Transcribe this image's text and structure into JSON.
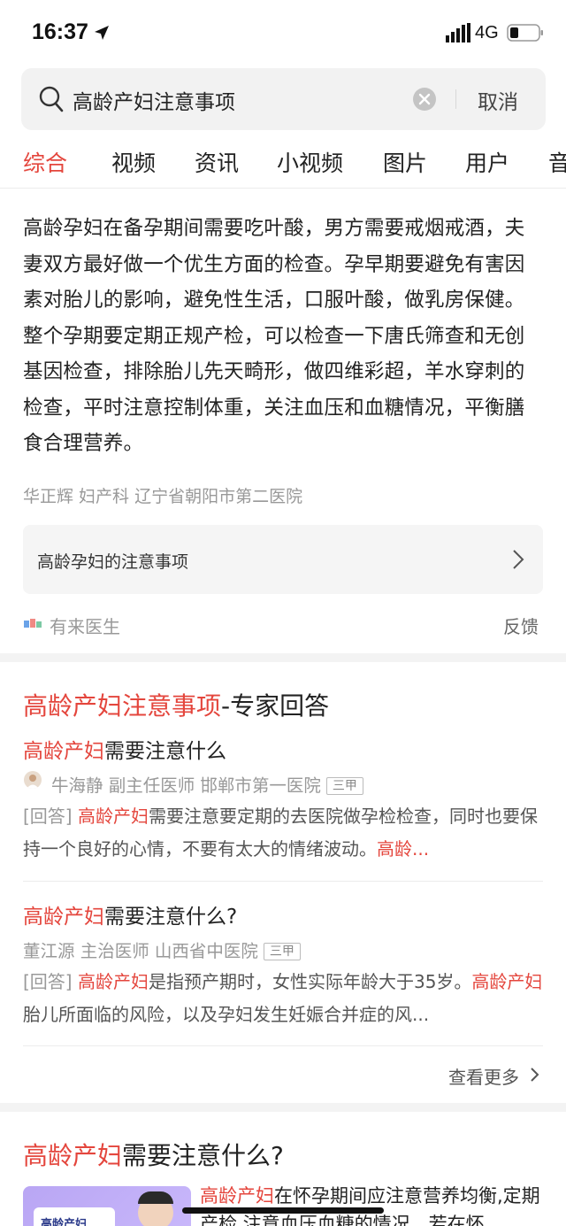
{
  "status_bar": {
    "time": "16:37",
    "network": "4G",
    "icons": [
      "location-arrow-icon",
      "signal-icon",
      "battery-icon"
    ]
  },
  "search": {
    "query": "高龄产妇注意事项",
    "cancel_label": "取消"
  },
  "tabs": [
    {
      "label": "综合",
      "active": true
    },
    {
      "label": "视频"
    },
    {
      "label": "资讯"
    },
    {
      "label": "小视频"
    },
    {
      "label": "图片"
    },
    {
      "label": "用户"
    },
    {
      "label": "音"
    }
  ],
  "answer_card": {
    "text": "高龄孕妇在备孕期间需要吃叶酸，男方需要戒烟戒酒，夫妻双方最好做一个优生方面的检查。孕早期要避免有害因素对胎儿的影响，避免性生活，口服叶酸，做乳房保健。整个孕期要定期正规产检，可以检查一下唐氏筛查和无创基因检查，排除胎儿先天畸形，做四维彩超，羊水穿刺的检查，平时注意控制体重，关注血压和血糖情况，平衡膳食合理营养。",
    "doctor_meta": "华正辉 妇产科 辽宁省朝阳市第二医院",
    "related_question": "高龄孕妇的注意事项",
    "source": "有来医生",
    "feedback": "反馈"
  },
  "expert_card": {
    "title_highlight": "高龄产妇注意事项",
    "title_rest": "-专家回答",
    "items": [
      {
        "title_highlight": "高龄产妇",
        "title_rest": "需要注意什么",
        "meta": "牛海静 副主任医师 邯郸市第一医院",
        "grade": "三甲",
        "answer_tag": "[回答]",
        "answer_hl1": "高龄产妇",
        "answer_text1": "需要注意要定期的去医院做孕检检查，同时也要保持一个良好的心情，不要有太大的情绪波动。",
        "answer_hl2": "高龄..."
      },
      {
        "title_highlight": "高龄产妇",
        "title_rest": "需要注意什么?",
        "meta": "董江源 主治医师 山西省中医院",
        "grade": "三甲",
        "answer_tag": "[回答]",
        "answer_hl1": "高龄产妇",
        "answer_text1": "是指预产期时，女性实际年龄大于35岁。",
        "answer_hl2": "高龄产妇",
        "answer_text2": "胎儿所面临的风险，以及孕妇发生妊娠合并症的风..."
      }
    ],
    "more_label": "查看更多"
  },
  "article_card": {
    "title_highlight": "高龄产妇",
    "title_rest": "需要注意什么?",
    "thumb_label": "高龄产妇",
    "snippet_highlight": "高龄产妇",
    "snippet_rest": "在怀孕期间应注意营养均衡,定期产检,注意血压血糖的情况，若在怀"
  },
  "colors": {
    "accent": "#e4463d",
    "muted": "#999999",
    "gap": "#f3f3f3"
  }
}
